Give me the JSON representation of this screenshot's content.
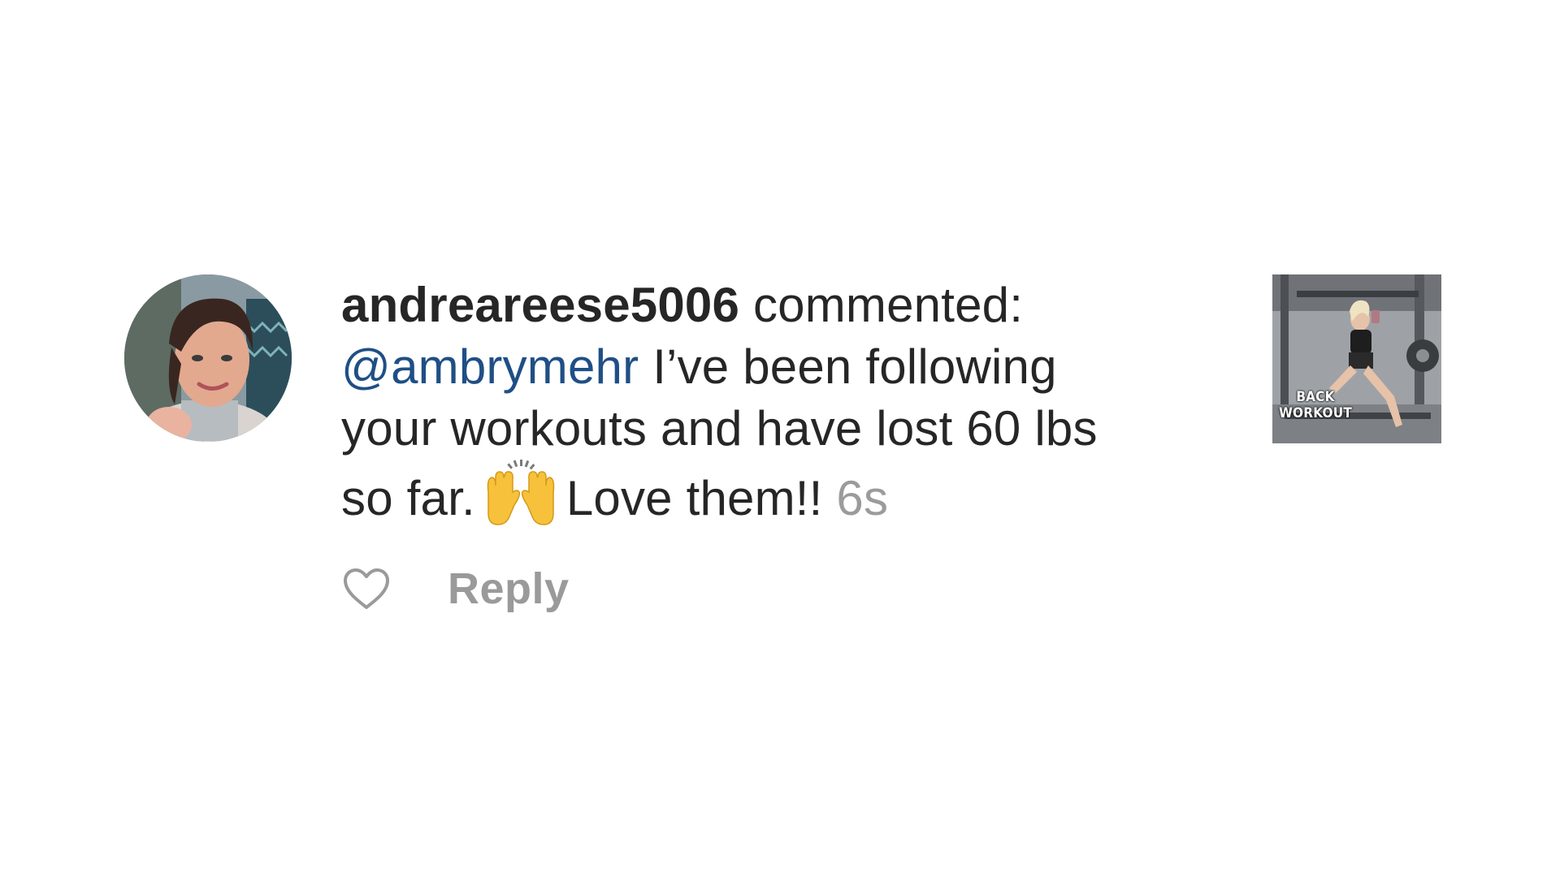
{
  "notification": {
    "username": "andreareese5006",
    "action": "commented:",
    "mention": "@ambrymehr",
    "message_line1": "I’ve been following",
    "message_line2": "your workouts and have lost 60 lbs",
    "message_line3_before_emoji": "so far.",
    "emoji_name": "raising-hands-emoji",
    "message_line3_after_emoji": "Love them!!",
    "timestamp": "6s"
  },
  "actions": {
    "like_icon": "heart-outline-icon",
    "reply_label": "Reply"
  },
  "post_thumbnail": {
    "caption_line1": "BACK",
    "caption_line2": "WORKOUT"
  },
  "colors": {
    "text": "#262626",
    "mention": "#1f4f86",
    "muted": "#9b9b9b"
  }
}
